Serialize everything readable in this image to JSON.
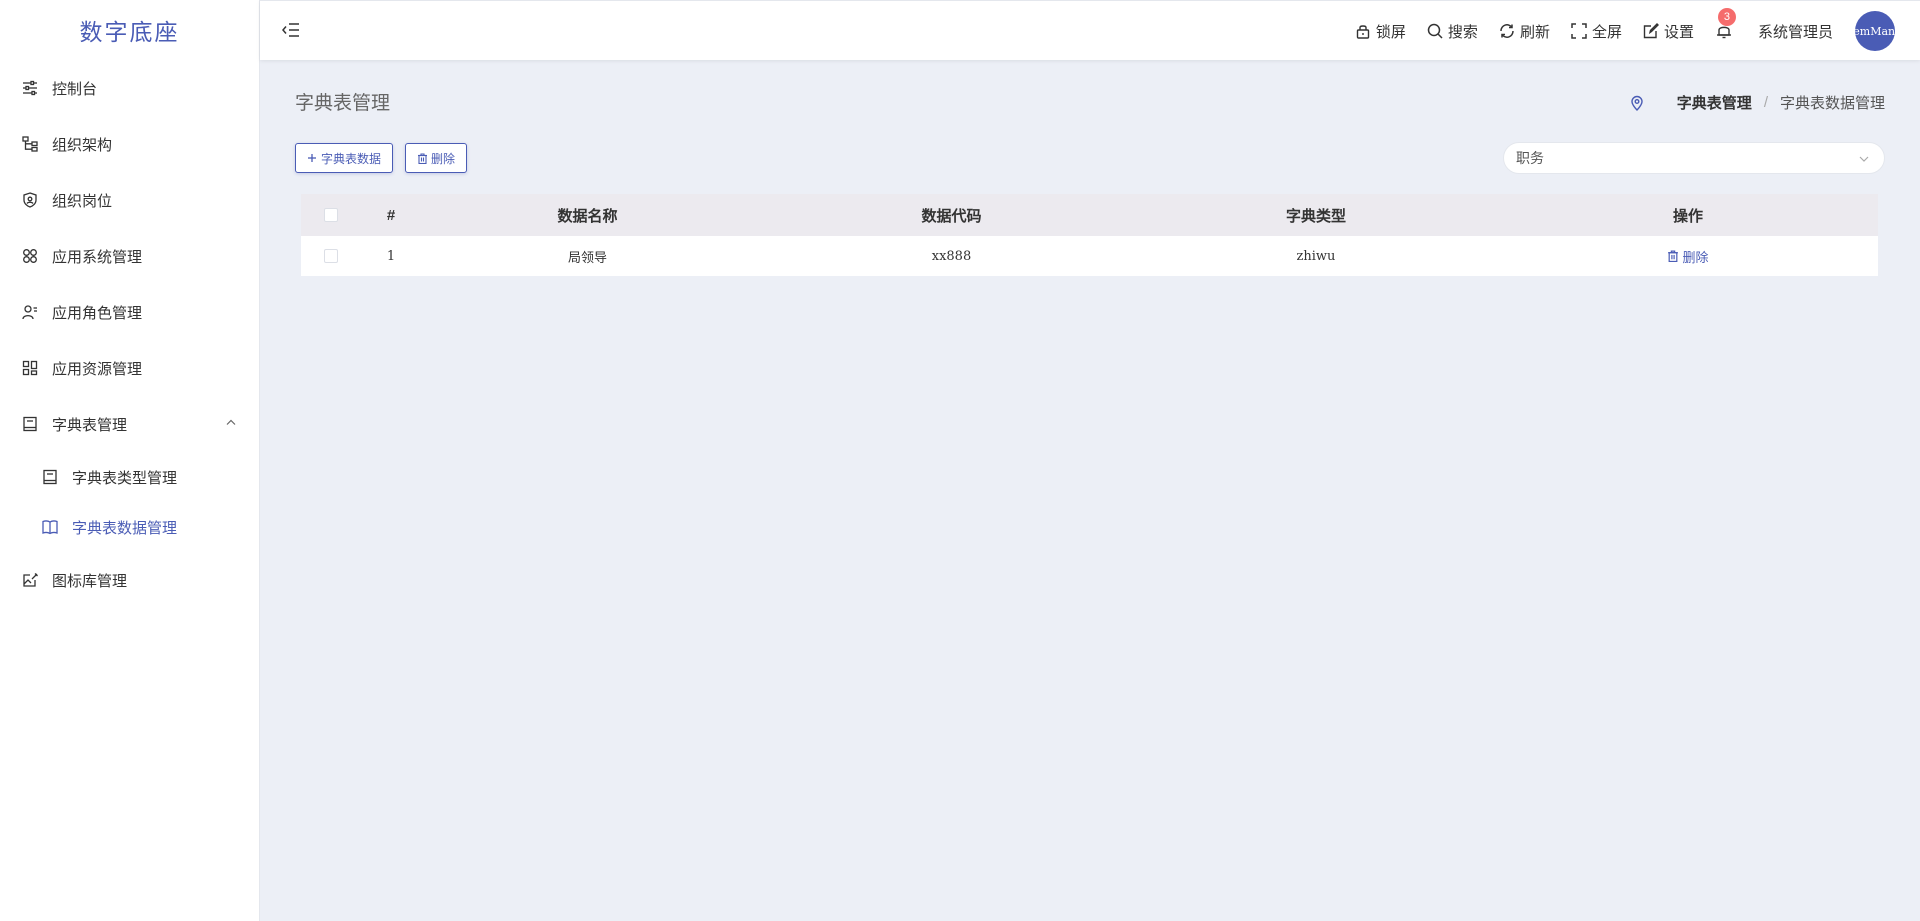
{
  "app": {
    "logo_text": "数字底座"
  },
  "sidebar": {
    "items": [
      {
        "label": "控制台",
        "icon": "sliders-icon"
      },
      {
        "label": "组织架构",
        "icon": "org-tree-icon"
      },
      {
        "label": "组织岗位",
        "icon": "badge-shield-icon"
      },
      {
        "label": "应用系统管理",
        "icon": "apps-grid-icon"
      },
      {
        "label": "应用角色管理",
        "icon": "user-list-icon"
      },
      {
        "label": "应用资源管理",
        "icon": "resource-grid-icon"
      },
      {
        "label": "字典表管理",
        "icon": "book-icon",
        "expanded": true,
        "children": [
          {
            "label": "字典表类型管理",
            "icon": "book-icon"
          },
          {
            "label": "字典表数据管理",
            "icon": "open-book-icon",
            "active": true
          }
        ]
      },
      {
        "label": "图标库管理",
        "icon": "edit-image-icon"
      }
    ]
  },
  "header": {
    "tools": [
      {
        "label": "锁屏",
        "icon": "lock-icon"
      },
      {
        "label": "搜索",
        "icon": "search-icon"
      },
      {
        "label": "刷新",
        "icon": "refresh-icon"
      },
      {
        "label": "全屏",
        "icon": "fullscreen-icon"
      },
      {
        "label": "设置",
        "icon": "settings-edit-icon"
      }
    ],
    "notification_count": "3",
    "username": "系统管理员",
    "avatar_text": "SystemManager"
  },
  "page": {
    "title": "字典表管理",
    "breadcrumb": [
      "字典表管理",
      "/",
      "字典表数据管理"
    ],
    "add_button": "字典表数据",
    "delete_button": "删除",
    "filter_select": {
      "value": "职务"
    }
  },
  "table": {
    "columns": [
      "#",
      "数据名称",
      "数据代码",
      "字典类型",
      "操作"
    ],
    "rows": [
      {
        "index": "1",
        "name": "局领导",
        "code": "xx888",
        "type": "zhiwu",
        "op_label": "删除"
      }
    ]
  },
  "colors": {
    "accent": "#4a5cb5",
    "badge": "#f56c6c",
    "background": "#eceff6"
  }
}
